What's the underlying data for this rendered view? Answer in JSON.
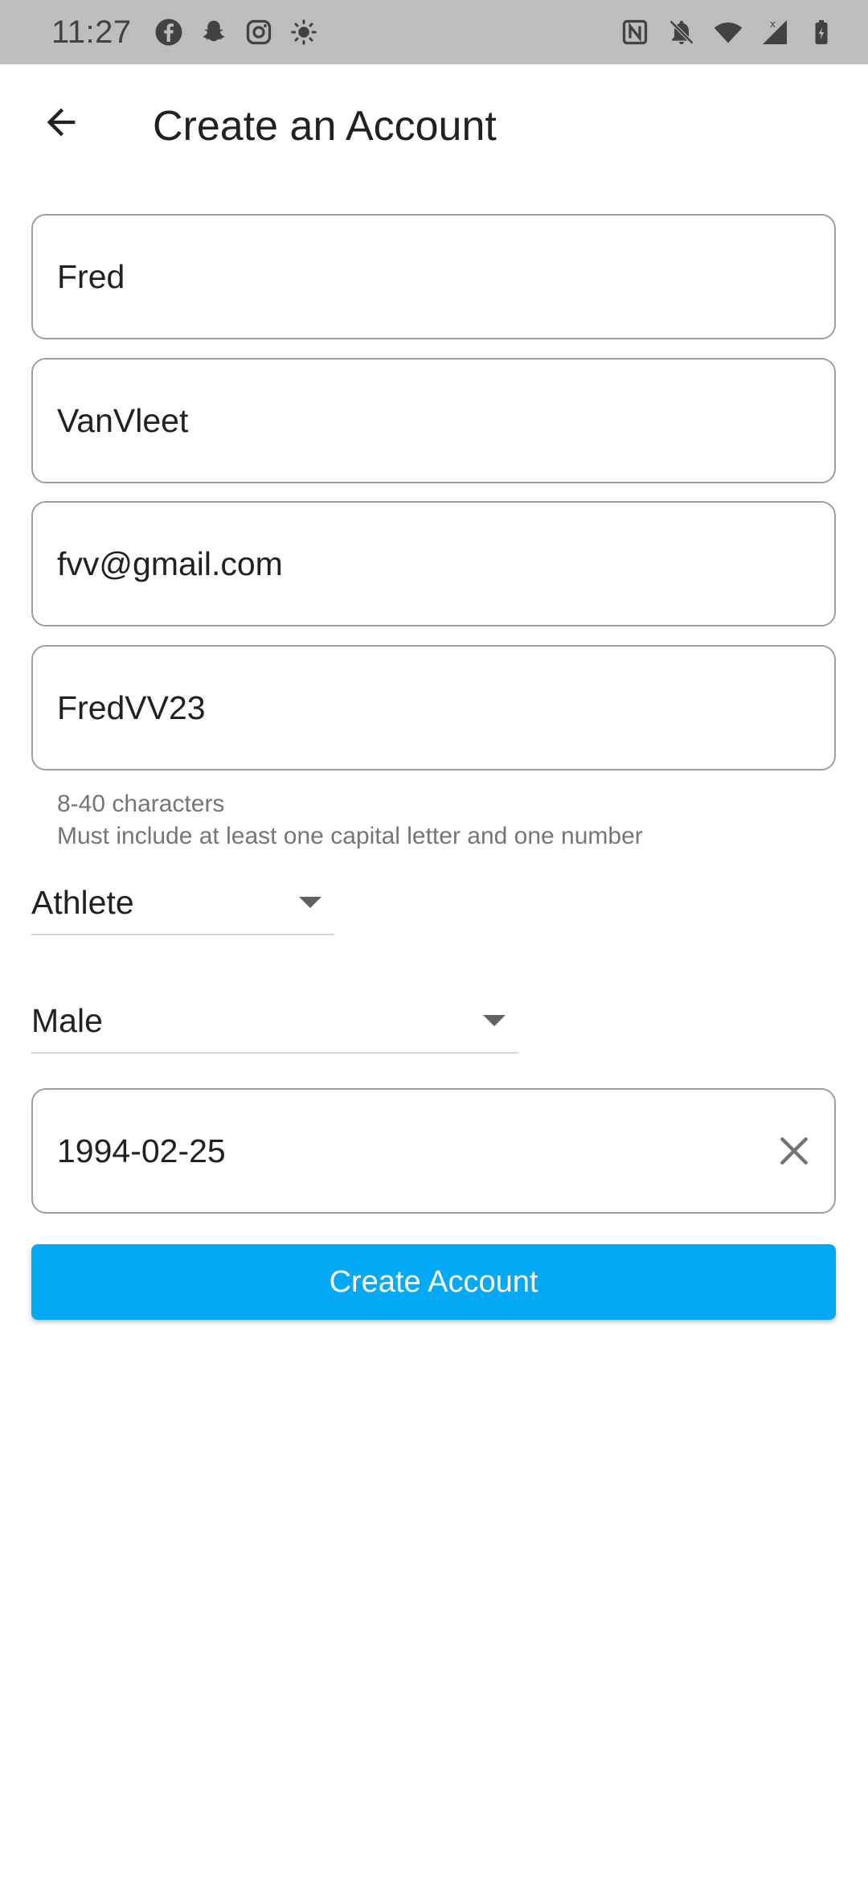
{
  "status_bar": {
    "time": "11:27",
    "left_icons": [
      "facebook-icon",
      "snapchat-icon",
      "instagram-icon",
      "brightness-icon"
    ],
    "right_icons": [
      "nfc-icon",
      "notifications-off-icon",
      "wifi-icon",
      "cellular-signal-icon",
      "battery-charging-icon"
    ]
  },
  "app_bar": {
    "title": "Create an Account",
    "back_icon": "arrow-back-icon"
  },
  "form": {
    "first_name": {
      "value": "Fred"
    },
    "last_name": {
      "value": "VanVleet"
    },
    "email": {
      "value": "fvv@gmail.com"
    },
    "password": {
      "value": "FredVV23"
    },
    "password_helper": {
      "line1": "8-40 characters",
      "line2": "Must include at least one capital letter and one number"
    },
    "role": {
      "selected": "Athlete"
    },
    "gender": {
      "selected": "Male"
    },
    "birthdate": {
      "value": "1994-02-25",
      "clear_icon": "close-icon"
    },
    "submit_label": "Create Account"
  },
  "colors": {
    "status_bar_bg": "#bdbdbd",
    "primary": "#03a9f4",
    "field_border": "#9e9e9e",
    "helper_text": "#757575"
  }
}
